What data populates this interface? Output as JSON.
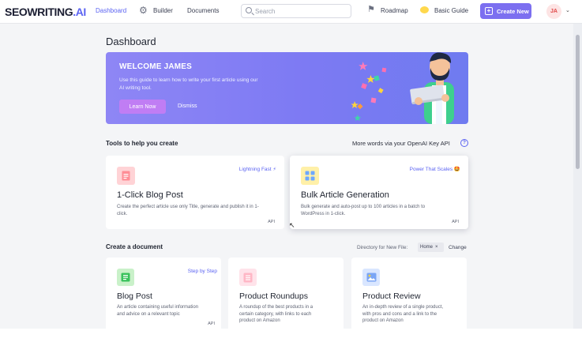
{
  "header": {
    "logo_main": "SEOWRITING",
    "logo_suffix": ".AI",
    "nav": {
      "dashboard": "Dashboard",
      "builder": "Builder",
      "documents": "Documents"
    },
    "search_placeholder": "Search",
    "roadmap": "Roadmap",
    "guide": "Basic Guide",
    "create_new": "Create New",
    "avatar_initials": "JA"
  },
  "page": {
    "title": "Dashboard"
  },
  "banner": {
    "title": "WELCOME JAMES",
    "description": "Use this guide to learn how to write your first article using our AI writing tool.",
    "learn_now": "Learn Now",
    "dismiss": "Dismiss"
  },
  "tools": {
    "heading": "Tools to help you create",
    "openai_link": "More words via your OpenAI Key API",
    "help_mark": "?",
    "cards": [
      {
        "badge": "Lightning Fast",
        "badge_emoji": "⚡",
        "name": "1-Click Blog Post",
        "description": "Create the perfect article use only Title, generate and publish it in 1-click.",
        "api": "API"
      },
      {
        "badge": "Power That Scales",
        "badge_emoji": "🤩",
        "name": "Bulk Article Generation",
        "description": "Bulk generate and auto-post up to 100 articles in a batch to WordPress in 1-click.",
        "api": "API"
      }
    ]
  },
  "documents": {
    "heading": "Create a document",
    "directory_label": "Directory for New File:",
    "directory_value": "Home",
    "change": "Change",
    "cards": [
      {
        "badge": "Step by Step",
        "name": "Blog Post",
        "description": "An article containing useful information and advice on a relevant topic",
        "api": "API"
      },
      {
        "badge": "",
        "name": "Product Roundups",
        "description": "A roundup of the best products in a certain category, with links to each product on Amazon",
        "api": ""
      },
      {
        "badge": "",
        "name": "Product Review",
        "description": "An in-depth review of a single product, with pros and cons and a link to the product on Amazon",
        "api": ""
      }
    ]
  },
  "colors": {
    "accent": "#5b63f2",
    "create_button": "#7c6ff0",
    "banner_from": "#8e86f5",
    "banner_to": "#6f7bf0",
    "learn_button": "#c07df4"
  },
  "icons": [
    "builder-gear-icon",
    "search-icon",
    "roadmap-icon",
    "guide-icon",
    "plus-icon",
    "chevron-down-icon",
    "help-icon",
    "document-icon",
    "grid-icon",
    "list-icon",
    "checklist-icon",
    "image-icon"
  ]
}
